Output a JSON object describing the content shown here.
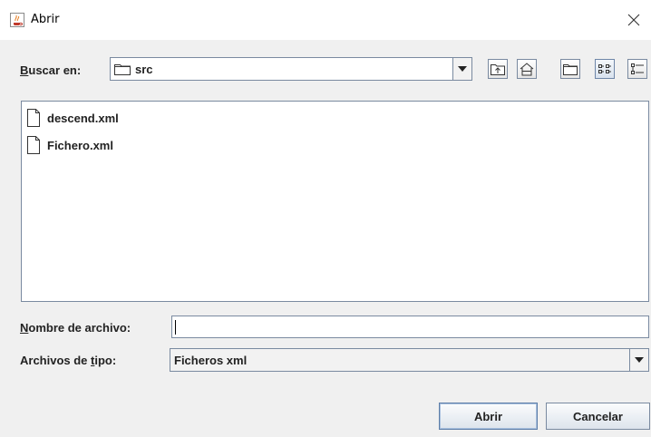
{
  "window": {
    "title": "Abrir"
  },
  "look_in": {
    "label_mnemonic": "B",
    "label_rest": "uscar en:",
    "value": "src"
  },
  "toolbar": {
    "icons": [
      "up-folder-icon",
      "home-icon",
      "new-folder-icon",
      "list-view-icon",
      "details-view-icon"
    ],
    "selected_view": "list-view-icon"
  },
  "files": [
    {
      "name": "descend.xml"
    },
    {
      "name": "Fichero.xml"
    }
  ],
  "file_name": {
    "label_mnemonic": "N",
    "label_rest": "ombre de archivo:",
    "value": ""
  },
  "file_type": {
    "label_start": "Archivos de ",
    "label_mnemonic": "t",
    "label_rest": "ipo:",
    "value": "Ficheros xml"
  },
  "buttons": {
    "open": "Abrir",
    "cancel": "Cancelar"
  },
  "colors": {
    "background": "#f0f0f0",
    "border": "#7a8aa0"
  }
}
